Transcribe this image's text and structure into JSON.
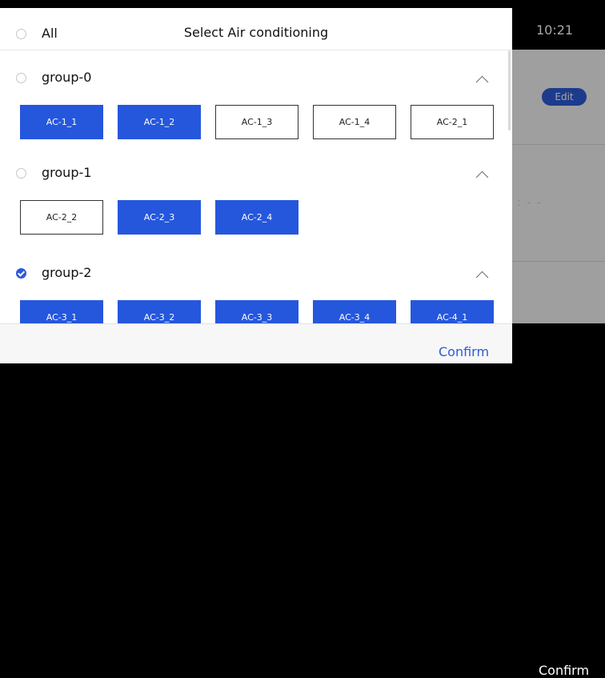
{
  "background": {
    "time": "10:21",
    "edit_label": "Edit",
    "dashes": ":  - -",
    "confirm_label": "Confirm"
  },
  "dialog": {
    "title": "Select Air conditioning",
    "all_label": "All",
    "confirm_label": "Confirm",
    "groups": [
      {
        "label": "group-0",
        "checked": false,
        "units": [
          {
            "label": "AC-1_1",
            "selected": true
          },
          {
            "label": "AC-1_2",
            "selected": true
          },
          {
            "label": "AC-1_3",
            "selected": false
          },
          {
            "label": "AC-1_4",
            "selected": false
          },
          {
            "label": "AC-2_1",
            "selected": false
          }
        ]
      },
      {
        "label": "group-1",
        "checked": false,
        "units": [
          {
            "label": "AC-2_2",
            "selected": false
          },
          {
            "label": "AC-2_3",
            "selected": true
          },
          {
            "label": "AC-2_4",
            "selected": true
          }
        ]
      },
      {
        "label": "group-2",
        "checked": true,
        "units": [
          {
            "label": "AC-3_1",
            "selected": true
          },
          {
            "label": "AC-3_2",
            "selected": true
          },
          {
            "label": "AC-3_3",
            "selected": true
          },
          {
            "label": "AC-3_4",
            "selected": true
          },
          {
            "label": "AC-4_1",
            "selected": true
          }
        ]
      }
    ]
  },
  "colors": {
    "accent": "#2557dd",
    "text": "#111111",
    "border": "#333333"
  }
}
